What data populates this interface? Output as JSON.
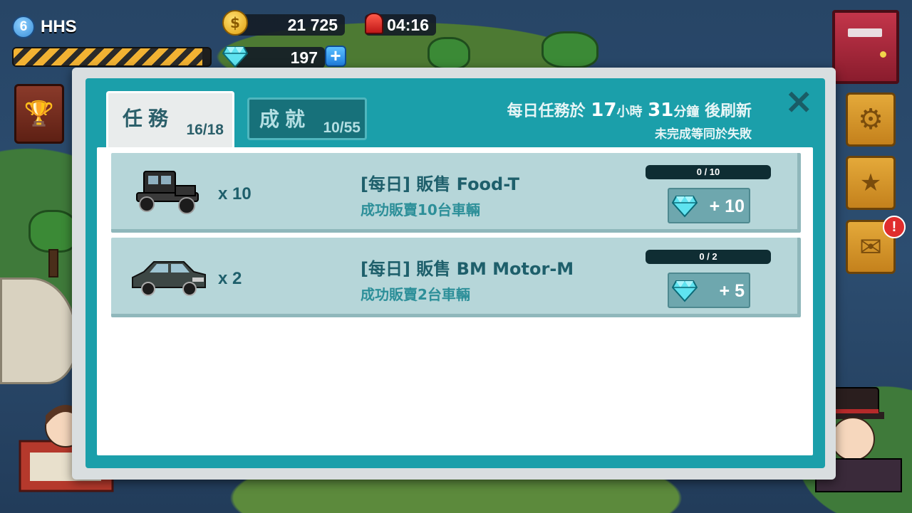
{
  "hud": {
    "level": "6",
    "player_name": "HHS",
    "xp_fraction": 0.96,
    "coins": "21 725",
    "gems": "197",
    "timer": "04:16",
    "plus_label": "+"
  },
  "side_buttons": {
    "exit_icon": "exit-door-icon",
    "settings_icon": "gear-icon",
    "ranking_icon": "podium-icon",
    "mail_icon": "mail-icon",
    "mail_notification": "!",
    "trophy_icon": "trophy-book-icon"
  },
  "modal": {
    "tabs": [
      {
        "label": "任務",
        "count": "16/18",
        "active": true
      },
      {
        "label": "成就",
        "count": "10/55",
        "active": false
      }
    ],
    "refresh_prefix": "每日任務於",
    "refresh_hours": "17",
    "refresh_hours_unit": "小時",
    "refresh_minutes": "31",
    "refresh_minutes_unit": "分鐘",
    "refresh_suffix": "後刷新",
    "fail_note": "未完成等同於失敗",
    "close_label": "✕"
  },
  "missions": [
    {
      "car_icon": "model-t-car-icon",
      "quantity": "x 10",
      "title": "[每日] 販售 Food-T",
      "description": "成功販賣10台車輛",
      "progress_text": "0 / 10",
      "progress_fraction": 0,
      "reward": "+ 10",
      "reward_icon": "diamond-icon"
    },
    {
      "car_icon": "sedan-car-icon",
      "quantity": "x 2",
      "title": "[每日] 販售 BM Motor-M",
      "description": "成功販賣2台車輛",
      "progress_text": "0 / 2",
      "progress_fraction": 0,
      "reward": "+ 5",
      "reward_icon": "diamond-icon"
    }
  ],
  "colors": {
    "modal_teal": "#1b9faa",
    "row_bg": "#b6d6d9",
    "text_dark_teal": "#1e5f6b",
    "gold": "#f2b233"
  }
}
